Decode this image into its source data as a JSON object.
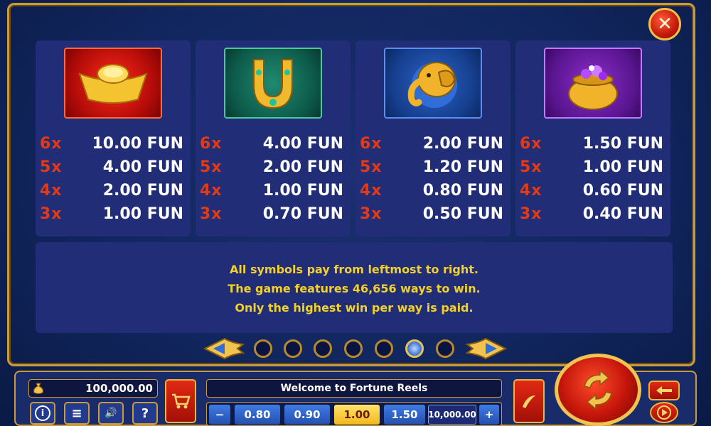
{
  "close_label": "✕",
  "symbols": [
    {
      "name": "gold-ingot",
      "payouts": [
        {
          "mult": "6x",
          "value": "10.00 FUN"
        },
        {
          "mult": "5x",
          "value": "4.00 FUN"
        },
        {
          "mult": "4x",
          "value": "2.00 FUN"
        },
        {
          "mult": "3x",
          "value": "1.00 FUN"
        }
      ]
    },
    {
      "name": "horseshoe",
      "payouts": [
        {
          "mult": "6x",
          "value": "4.00 FUN"
        },
        {
          "mult": "5x",
          "value": "2.00 FUN"
        },
        {
          "mult": "4x",
          "value": "1.00 FUN"
        },
        {
          "mult": "3x",
          "value": "0.70 FUN"
        }
      ]
    },
    {
      "name": "golden-elephant",
      "payouts": [
        {
          "mult": "6x",
          "value": "2.00 FUN"
        },
        {
          "mult": "5x",
          "value": "1.20 FUN"
        },
        {
          "mult": "4x",
          "value": "0.80 FUN"
        },
        {
          "mult": "3x",
          "value": "0.50 FUN"
        }
      ]
    },
    {
      "name": "treasure-pot",
      "payouts": [
        {
          "mult": "6x",
          "value": "1.50 FUN"
        },
        {
          "mult": "5x",
          "value": "1.00 FUN"
        },
        {
          "mult": "4x",
          "value": "0.60 FUN"
        },
        {
          "mult": "3x",
          "value": "0.40 FUN"
        }
      ]
    }
  ],
  "info_lines": [
    "All symbols pay from leftmost to right.",
    "The game features 46,656 ways to win.",
    "Only the highest win per way is paid."
  ],
  "pagination": {
    "pages": 7,
    "current": 6
  },
  "balance": "100,000.00",
  "message": "Welcome to Fortune Reels",
  "bet_minus": "−",
  "bet_plus": "+",
  "bet_options": [
    "0.80",
    "0.90",
    "1.00",
    "1.50"
  ],
  "selected_bet": "1.00",
  "total_bet": "10,000.00",
  "small_buttons": {
    "info": "i",
    "menu": "≡",
    "sound": "🔊",
    "help": "?"
  },
  "colors": {
    "accent_gold": "#c99b3a",
    "panel": "#222d78",
    "multiplier_red": "#e33a16",
    "info_yellow": "#f2d22a"
  }
}
